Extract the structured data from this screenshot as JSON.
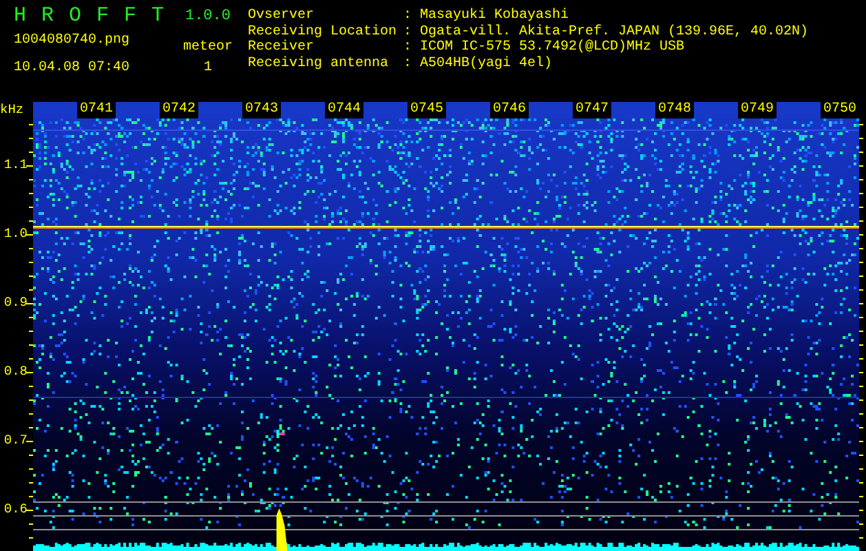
{
  "header": {
    "title": "H R O F F T",
    "version": "1.0.0",
    "file_name": "1004080740.png",
    "timestamp": "10.04.08 07:40",
    "meteor_label": "meteor",
    "meteor_count": "1"
  },
  "station_info": [
    {
      "label": "Ovserver",
      "separator": ":",
      "value": "Masayuki Kobayashi"
    },
    {
      "label": "Receiving Location",
      "separator": ":",
      "value": "Ogata-vill. Akita-Pref. JAPAN (139.96E, 40.02N)"
    },
    {
      "label": "Receiver",
      "separator": ":",
      "value": "ICOM IC-575 53.7492(@LCD)MHz USB"
    },
    {
      "label": "Receiving antenna",
      "separator": ":",
      "value": "A504HB(yagi 4el)"
    }
  ],
  "spectrogram": {
    "unit": "kHz",
    "y_labels": [
      "1.1",
      "1.0",
      "0.9",
      "0.8",
      "0.7",
      "0.6"
    ],
    "time_labels": [
      "0741",
      "0742",
      "0743",
      "0744",
      "0745",
      "0746",
      "0747",
      "0748",
      "0749",
      "0750"
    ]
  }
}
